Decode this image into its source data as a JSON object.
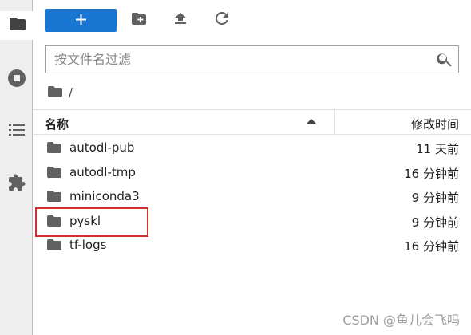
{
  "sidebar": {
    "items": [
      {
        "icon": "folder-icon"
      },
      {
        "icon": "stop-icon"
      },
      {
        "icon": "list-icon"
      },
      {
        "icon": "puzzle-icon"
      }
    ]
  },
  "toolbar": {
    "new_label": "+",
    "icons": [
      "new-folder-icon",
      "upload-icon",
      "refresh-icon"
    ]
  },
  "filter": {
    "placeholder": "按文件名过滤",
    "value": ""
  },
  "breadcrumb": {
    "separator": "/"
  },
  "file_list": {
    "columns": {
      "name": "名称",
      "modified": "修改时间"
    },
    "rows": [
      {
        "name": "autodl-pub",
        "modified": "11 天前"
      },
      {
        "name": "autodl-tmp",
        "modified": "16 分钟前"
      },
      {
        "name": "miniconda3",
        "modified": "9 分钟前"
      },
      {
        "name": "pyskl",
        "modified": "9 分钟前"
      },
      {
        "name": "tf-logs",
        "modified": "16 分钟前"
      }
    ]
  },
  "watermark": "CSDN @鱼儿会飞吗",
  "colors": {
    "accent": "#1976d2",
    "highlight": "#d32f2f",
    "sidebar_bg": "#eeeeee"
  }
}
